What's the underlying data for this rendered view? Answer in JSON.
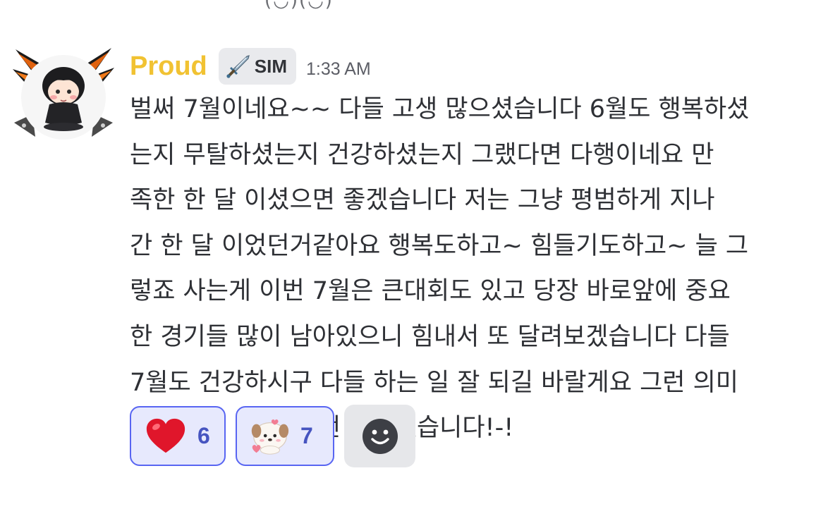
{
  "top_fragment": "(◡)(◡)",
  "message": {
    "author": "Proud",
    "author_color": "#f1c232",
    "role_tag": {
      "icon": "sword-icon",
      "label": "SIM"
    },
    "timestamp": "1:33 AM",
    "lines": [
      "벌써 7월이네요~~ 다들 고생 많으셨습니다 6월도 행복하셨",
      "는지 무탈하셨는지 건강하셨는지 그랬다면 다행이네요 만",
      "족한 한 달 이셨으면 좋겠습니다 저는 그냥 평범하게 지나",
      "간 한 달 이었던거같아요 행복도하고~ 힘들기도하고~ 늘 그",
      "렇죠 사는게 이번 7월은 큰대회도 있고 당장 바로앞에 중요",
      "한 경기들 많이 남아있으니 힘내서 또 달려보겠습니다 다들",
      "7월도 건강하시구 다들 하는 일 잘 되길 바랄게요 그런 의미",
      "로~ 내일 방송 한 번 켜보겠습니다!-!"
    ]
  },
  "reactions": [
    {
      "emoji": "heart-emoji",
      "count": "6",
      "selected": true
    },
    {
      "emoji": "puppy-heart-emoji",
      "count": "7",
      "selected": true
    }
  ],
  "add_reaction": {
    "icon": "smiley-icon"
  },
  "colors": {
    "accent": "#5865f2",
    "reaction_bg": "#e7e9fd",
    "reaction_count": "#4654c0",
    "text": "#2e3035",
    "muted": "#5c5e66"
  }
}
